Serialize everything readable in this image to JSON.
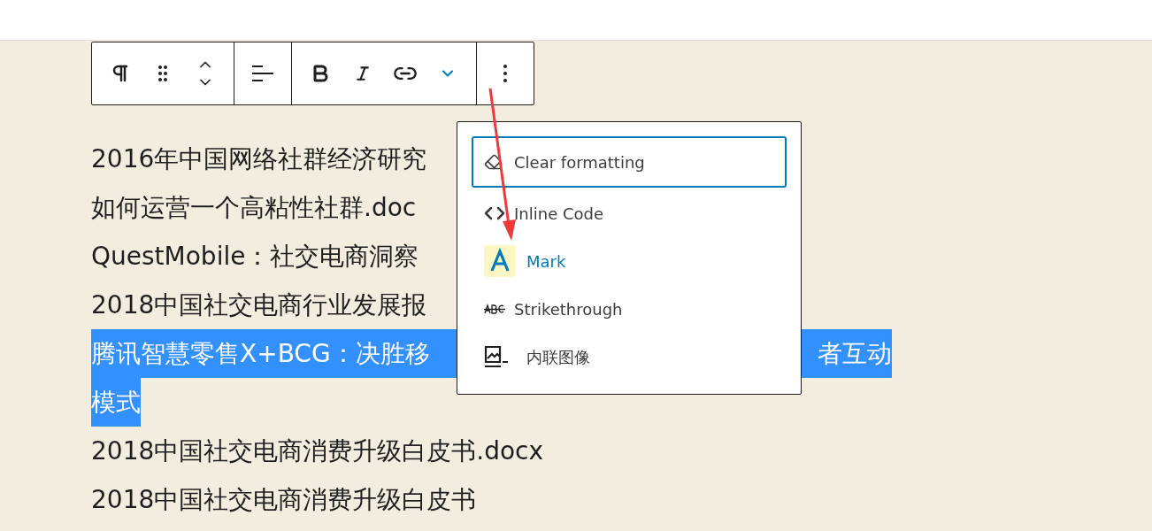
{
  "paragraphs": [
    {
      "text": "2016年中国网络社群经济研究",
      "selected": false
    },
    {
      "text": "如何运营一个高粘性社群.doc",
      "selected": false
    },
    {
      "text": "QuestMobile：社交电商洞察",
      "selected": false
    },
    {
      "text": "2018中国社交电商行业发展报",
      "selected": false
    },
    {
      "text": "腾讯智慧零售X+BCG：决胜移",
      "text_end": "者互动",
      "continuation": "模式",
      "selected": true
    },
    {
      "text": "2018中国社交电商消费升级白皮书.docx",
      "selected": false
    },
    {
      "text": "2018中国社交电商消费升级白皮书",
      "selected": false
    }
  ],
  "toolbar": {
    "groups": [
      [
        {
          "kind": "paragraph"
        },
        {
          "kind": "drag"
        },
        {
          "kind": "move"
        }
      ],
      [
        {
          "kind": "align"
        }
      ],
      [
        {
          "kind": "bold"
        },
        {
          "kind": "italic"
        },
        {
          "kind": "link"
        },
        {
          "kind": "more-formats",
          "expanded": true
        }
      ],
      [
        {
          "kind": "options"
        }
      ]
    ]
  },
  "format_menu": {
    "items": [
      {
        "kind": "eraser",
        "label": "Clear formatting",
        "focused": true
      },
      {
        "kind": "code",
        "label": "Inline Code",
        "focused": false
      },
      {
        "kind": "mark",
        "label": "Mark",
        "focused": false
      },
      {
        "kind": "strike",
        "label": "Strikethrough",
        "focused": false
      },
      {
        "kind": "image",
        "label": "内联图像",
        "focused": false
      }
    ]
  }
}
